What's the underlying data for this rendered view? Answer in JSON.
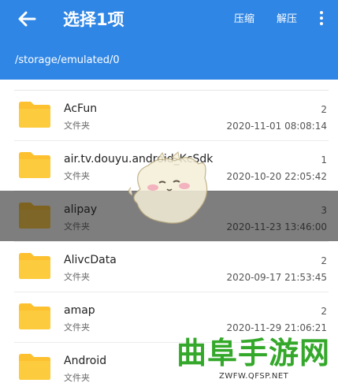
{
  "header": {
    "title": "选择1项",
    "compress_label": "压缩",
    "extract_label": "解压",
    "path": "/storage/emulated/0",
    "bg_color": "#2f86e5"
  },
  "files": [
    {
      "name": "AcFun",
      "type": "文件夹",
      "count": "2",
      "date": "2020-11-01 08:08:14"
    },
    {
      "name": "air.tv.douyu.android_KcSdk",
      "type": "文件夹",
      "count": "1",
      "date": "2020-10-20 22:05:42"
    },
    {
      "name": "alipay",
      "type": "文件夹",
      "count": "3",
      "date": "2020-11-23 13:46:00"
    },
    {
      "name": "AlivcData",
      "type": "文件夹",
      "count": "2",
      "date": "2020-09-17 21:53:45"
    },
    {
      "name": "amap",
      "type": "文件夹",
      "count": "2",
      "date": "2020-11-29 21:06:21"
    },
    {
      "name": "Android",
      "type": "文件夹",
      "count": "",
      "date": ""
    }
  ],
  "folder_icon_color": "#fdc02f",
  "watermark": {
    "cn": "曲阜手游网",
    "en": "ZWFW.QFSP.NET"
  }
}
